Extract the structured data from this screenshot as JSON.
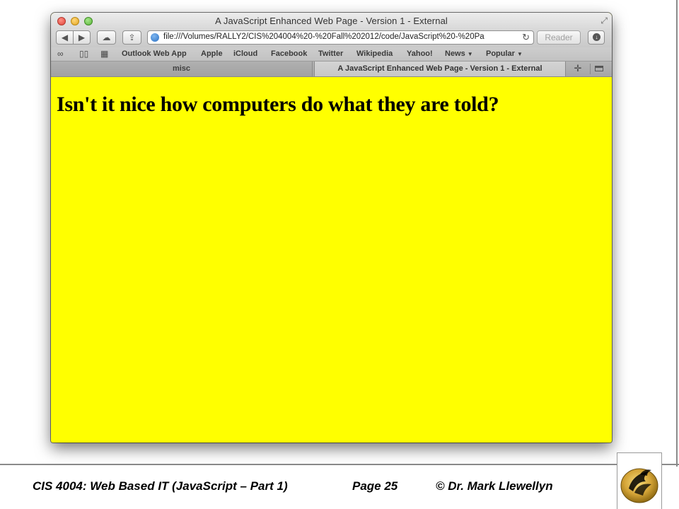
{
  "browser": {
    "window_title": "A JavaScript Enhanced Web Page - Version 1 - External",
    "url": "file:///Volumes/RALLY2/CIS%204004%20-%20Fall%202012/code/JavaScript%20-%20Pa",
    "reader_label": "Reader",
    "bookmarks": [
      "Outlook Web App",
      "Apple",
      "iCloud",
      "Facebook",
      "Twitter",
      "Wikipedia",
      "Yahoo!",
      "News",
      "Popular"
    ],
    "tabs": [
      {
        "label": "misc"
      },
      {
        "label": "A JavaScript Enhanced Web Page - Version 1 - External"
      }
    ]
  },
  "page": {
    "heading": "Isn't it nice how computers do what they are told?",
    "background_color": "#ffff00"
  },
  "footer": {
    "course": "CIS 4004: Web Based IT (JavaScript – Part 1)",
    "page": "Page 25",
    "copyright": "© Dr. Mark Llewellyn"
  }
}
